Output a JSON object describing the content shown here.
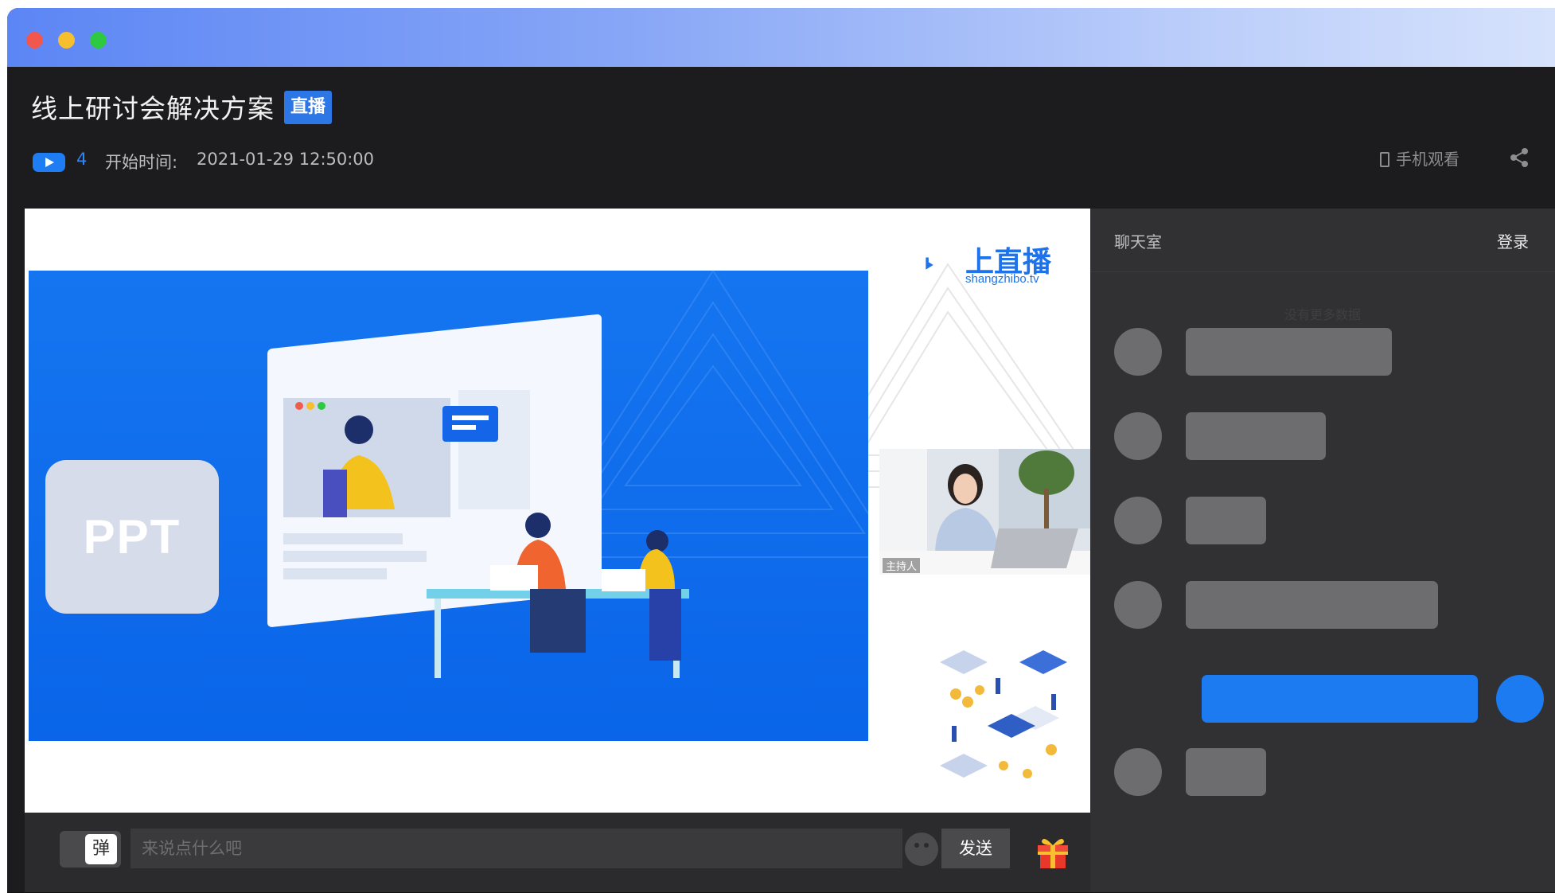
{
  "window": {
    "controls": [
      "close",
      "minimize",
      "maximize"
    ]
  },
  "header": {
    "title": "线上研讨会解决方案",
    "live_badge": "直播",
    "viewer_count": "4",
    "start_label": "开始时间:",
    "start_time": "2021-01-29 12:50:00",
    "mobile_watch": "手机观看",
    "share_icon": "share-icon"
  },
  "player": {
    "ppt_label": "PPT",
    "brand_name": "上直播",
    "brand_url": "shangzhibo.tv",
    "presenter_label": "主持人"
  },
  "inputbar": {
    "danmaku_toggle": "弹",
    "placeholder": "来说点什么吧",
    "send_label": "发送",
    "emoji_icon": "emoji-icon",
    "gift_icon": "gift-icon"
  },
  "chat": {
    "title": "聊天室",
    "login_label": "登录",
    "no_more": "没有更多数据",
    "messages": [
      {
        "self": false,
        "length": 0.72
      },
      {
        "self": false,
        "length": 0.49
      },
      {
        "self": false,
        "length": 0.28
      },
      {
        "self": false,
        "length": 0.88
      },
      {
        "self": true,
        "length": 0.88
      },
      {
        "self": false,
        "length": 0.28
      }
    ]
  },
  "colors": {
    "accent": "#1c7bf0",
    "live_badge": "#2d76e6",
    "background": "#1c1c1e",
    "chat_background": "#313133"
  }
}
